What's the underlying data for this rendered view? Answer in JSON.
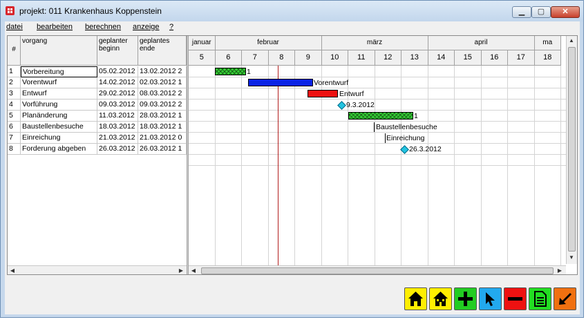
{
  "window": {
    "title": "projekt: 011  Krankenhaus Koppenstein"
  },
  "menu": [
    "datei",
    "bearbeiten",
    "berechnen",
    "anzeige",
    "?"
  ],
  "task_columns": {
    "num": "#",
    "vorgang": "vorgang",
    "start": "geplanter beginn",
    "end": "geplantes ende"
  },
  "tasks": [
    {
      "num": "1",
      "name": "Vorbereitung",
      "start": "05.02.2012",
      "end": "13.02.2012 2"
    },
    {
      "num": "2",
      "name": "Vorentwurf",
      "start": "14.02.2012",
      "end": "02.03.2012 1"
    },
    {
      "num": "3",
      "name": "Entwurf",
      "start": "29.02.2012",
      "end": "08.03.2012 2"
    },
    {
      "num": "4",
      "name": "Vorführung",
      "start": "09.03.2012",
      "end": "09.03.2012 2"
    },
    {
      "num": "5",
      "name": "Planänderung",
      "start": "11.03.2012",
      "end": "28.03.2012 1"
    },
    {
      "num": "6",
      "name": "Baustellenbesuche",
      "start": "18.03.2012",
      "end": "18.03.2012 1"
    },
    {
      "num": "7",
      "name": "Einreichung",
      "start": "21.03.2012",
      "end": "21.03.2012 0"
    },
    {
      "num": "8",
      "name": "Forderung abgeben",
      "start": "26.03.2012",
      "end": "26.03.2012 1"
    }
  ],
  "timeline": {
    "months": [
      "januar",
      "februar",
      "märz",
      "april",
      "ma"
    ],
    "weeks": [
      "5",
      "6",
      "7",
      "8",
      "9",
      "10",
      "11",
      "12",
      "13",
      "14",
      "15",
      "16",
      "17",
      "18"
    ]
  },
  "chart_labels": {
    "t1": "1",
    "t2": "Vorentwurf",
    "t3": "Entwurf",
    "t4": "9.3.2012",
    "t5": "1",
    "t6": "Baustellenbesuche",
    "t7": "Einreichung",
    "t8": "26.3.2012"
  },
  "colors": {
    "green": "#33cc33",
    "blue": "#0b24e6",
    "red": "#ee1111",
    "milestone": "#22c3e0",
    "today_line": "#b21c1c"
  },
  "toolbar": [
    "home-icon",
    "home-outline-icon",
    "plus-icon",
    "cursor-icon",
    "minus-icon",
    "list-icon",
    "arrow-down-left-icon"
  ]
}
